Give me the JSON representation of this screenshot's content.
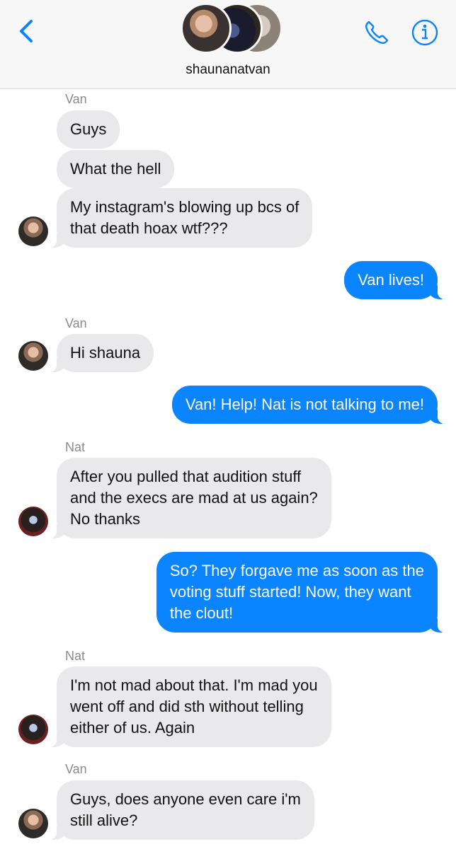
{
  "header": {
    "group_name": "shaunanatvan",
    "icons": [
      "back-chevron-icon",
      "phone-icon",
      "info-icon"
    ],
    "accent_color": "#0a84ff"
  },
  "messages": [
    {
      "sender": "Van",
      "text": "Guys"
    },
    {
      "text": "What the hell"
    },
    {
      "text": "My instagram's blowing up bcs of\nthat death hoax wtf???"
    },
    {
      "text": "Van lives!"
    },
    {
      "sender": "Van",
      "text": "Hi shauna"
    },
    {
      "text": "Van! Help! Nat is not talking to me!"
    },
    {
      "sender": "Nat",
      "text": "After you pulled that audition stuff\nand the execs are mad at us again?\nNo thanks"
    },
    {
      "text": "So? They forgave me as soon as the\nvoting stuff started! Now, they want\nthe clout!"
    },
    {
      "sender": "Nat",
      "text": "I'm not mad about that. I'm mad you\nwent off and did sth without telling\neither of us. Again"
    },
    {
      "sender": "Van",
      "text": "Guys, does anyone even care i'm\nstill alive?"
    }
  ],
  "colors": {
    "incoming_bubble": "#e9e9eb",
    "outgoing_bubble": "#0a84ff",
    "sender_label": "#8a8a8e"
  }
}
